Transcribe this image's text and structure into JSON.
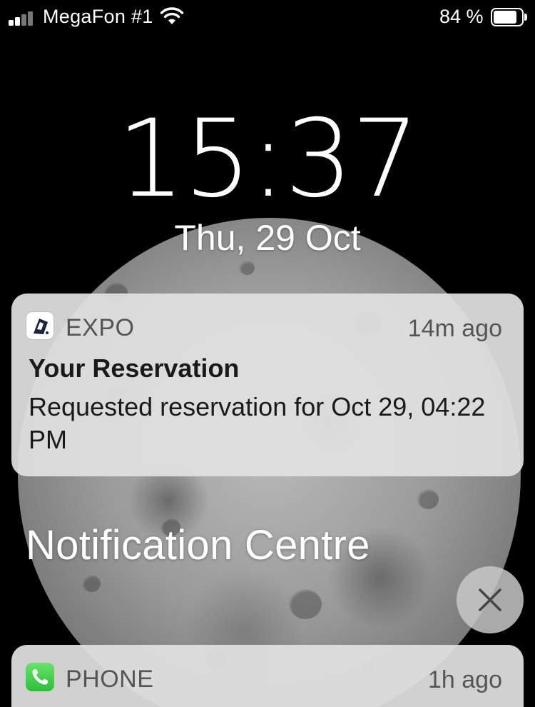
{
  "status_bar": {
    "carrier": "MegaFon #1",
    "signal_bars_filled": 2,
    "signal_bars_total": 4,
    "battery_percent_text": "84 %",
    "battery_level": 0.84,
    "icons": [
      "signal-icon",
      "wifi-icon",
      "battery-icon"
    ]
  },
  "lock_screen": {
    "time": "15:37",
    "date": "Thu, 29 Oct"
  },
  "notifications": [
    {
      "app": "EXPO",
      "icon": "expo-app-icon",
      "time_ago": "14m ago",
      "title": "Your Reservation",
      "body": "Requested reservation for Oct 29, 04:22 PM"
    },
    {
      "app": "PHONE",
      "icon": "phone-app-icon",
      "time_ago": "1h ago"
    }
  ],
  "notification_centre": {
    "title": "Notification Centre",
    "close_icon": "close-icon"
  },
  "colors": {
    "card_background": "#e1e1e1",
    "phone_icon_green": "#3cc845"
  }
}
